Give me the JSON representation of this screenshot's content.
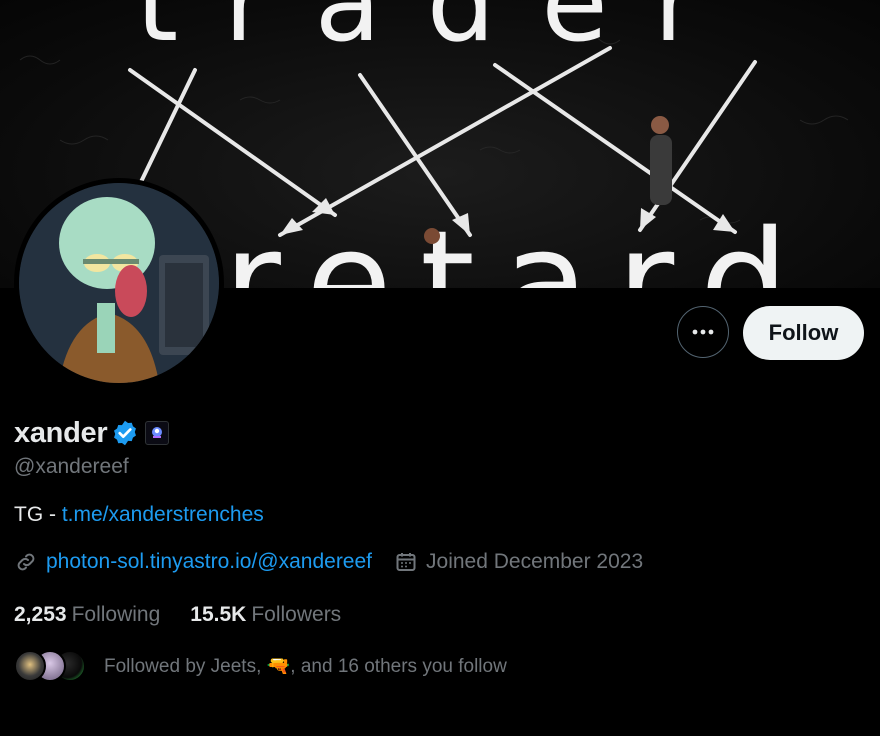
{
  "profile": {
    "display_name": "xander",
    "handle": "@xandereef",
    "bio_prefix": "TG - ",
    "bio_link": "t.me/xanderstrenches",
    "website": "photon-sol.tinyastro.io/@xandereef",
    "joined": "Joined December 2023"
  },
  "banner": {
    "top_text": "trader",
    "bottom_text": "retard"
  },
  "actions": {
    "more_icon": "more-horizontal-icon",
    "follow_label": "Follow"
  },
  "stats": {
    "following_count": "2,253",
    "following_label": "Following",
    "followers_count": "15.5K",
    "followers_label": "Followers"
  },
  "followed_by": {
    "text": "Followed by Jeets, 🔫, and 16 others you follow"
  },
  "colors": {
    "background": "#000000",
    "text_primary": "#e7e9ea",
    "text_secondary": "#71767b",
    "accent_link": "#1d9bf0",
    "verified_badge": "#1d9bf0",
    "follow_button_bg": "#eff3f4"
  },
  "icons": {
    "verified": "verified-badge-icon",
    "affiliate": "affiliate-badge-icon",
    "link": "link-icon",
    "calendar": "calendar-icon"
  }
}
